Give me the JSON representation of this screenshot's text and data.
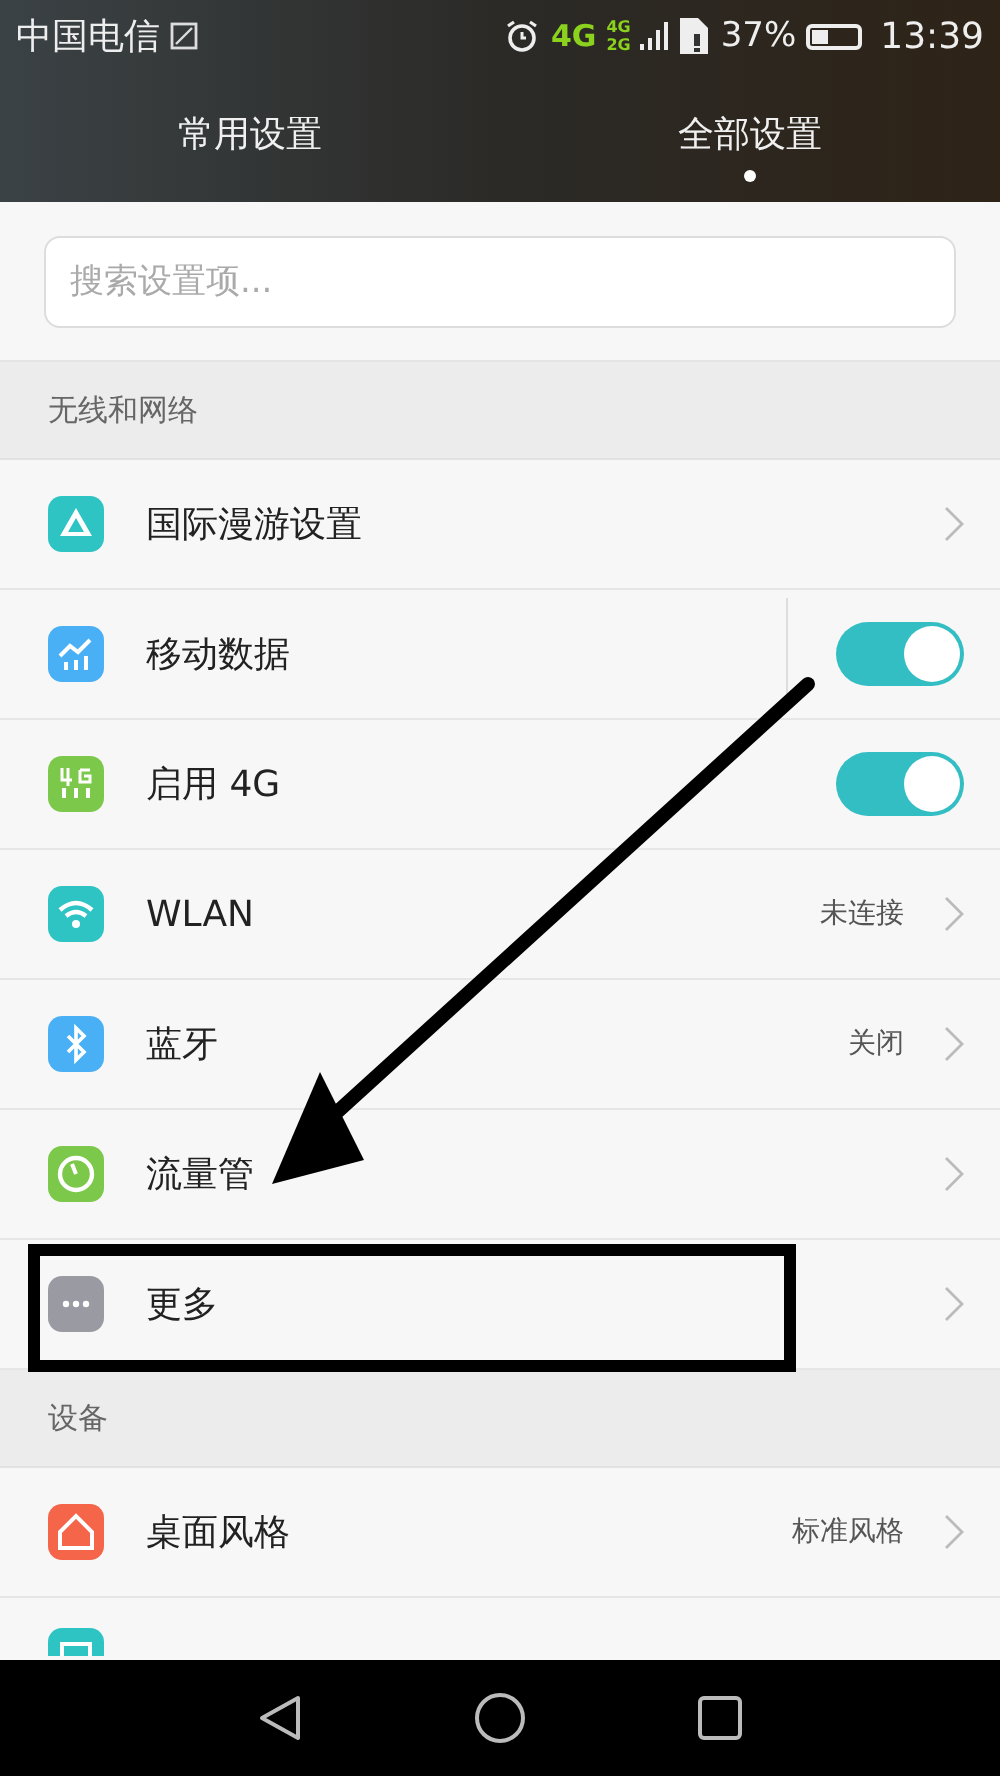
{
  "status_bar": {
    "carrier": "中国电信",
    "network": "4G",
    "sim2_network": [
      "4G",
      "2G"
    ],
    "battery": "37%",
    "time": "13:39"
  },
  "tabs": [
    {
      "label": "常用设置",
      "selected": false
    },
    {
      "label": "全部设置",
      "selected": true
    }
  ],
  "search": {
    "placeholder": "搜索设置项..."
  },
  "sections": [
    {
      "title": "无线和网络",
      "items": [
        {
          "kind": "link",
          "label": "国际漫游设置",
          "color": "#2ec4c4",
          "highlighted": false
        },
        {
          "kind": "toggle",
          "label": "移动数据",
          "color": "#4ab0f5",
          "on": true,
          "split": true,
          "highlighted": false
        },
        {
          "kind": "toggle",
          "label": "启用 4G",
          "color": "#7cc84a",
          "on": true,
          "split": false,
          "highlighted": false
        },
        {
          "kind": "link",
          "label": "WLAN",
          "value": "未连接",
          "color": "#2ec4c4",
          "highlighted": false
        },
        {
          "kind": "link",
          "label": "蓝牙",
          "value": "关闭",
          "color": "#4ab0f5",
          "highlighted": false
        },
        {
          "kind": "link",
          "label": "流量管",
          "color": "#7cc84a",
          "highlighted": false
        },
        {
          "kind": "link",
          "label": "更多",
          "color": "#9a9aa2",
          "highlighted": true
        }
      ]
    },
    {
      "title": "设备",
      "items": [
        {
          "kind": "link",
          "label": "桌面风格",
          "value": "标准风格",
          "color": "#f4654a",
          "highlighted": false
        },
        {
          "kind": "partial",
          "color": "#2ec4c4",
          "highlighted": false
        }
      ]
    }
  ]
}
